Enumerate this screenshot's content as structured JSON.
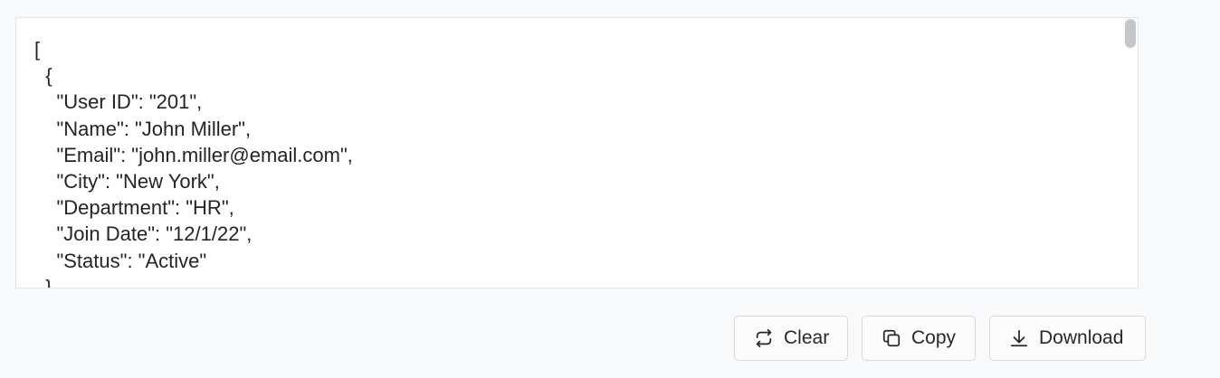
{
  "output": {
    "text": "[\n  {\n    \"User ID\": \"201\",\n    \"Name\": \"John Miller\",\n    \"Email\": \"john.miller@email.com\",\n    \"City\": \"New York\",\n    \"Department\": \"HR\",\n    \"Join Date\": \"12/1/22\",\n    \"Status\": \"Active\"\n  }"
  },
  "actions": {
    "clear_label": "Clear",
    "copy_label": "Copy",
    "download_label": "Download"
  },
  "icons": {
    "clear": "repeat-arrows-icon",
    "copy": "copy-icon",
    "download": "download-icon"
  },
  "colors": {
    "background": "#f8f9fb",
    "panel": "#ffffff",
    "text": "#222428",
    "border": "#d7dade"
  }
}
